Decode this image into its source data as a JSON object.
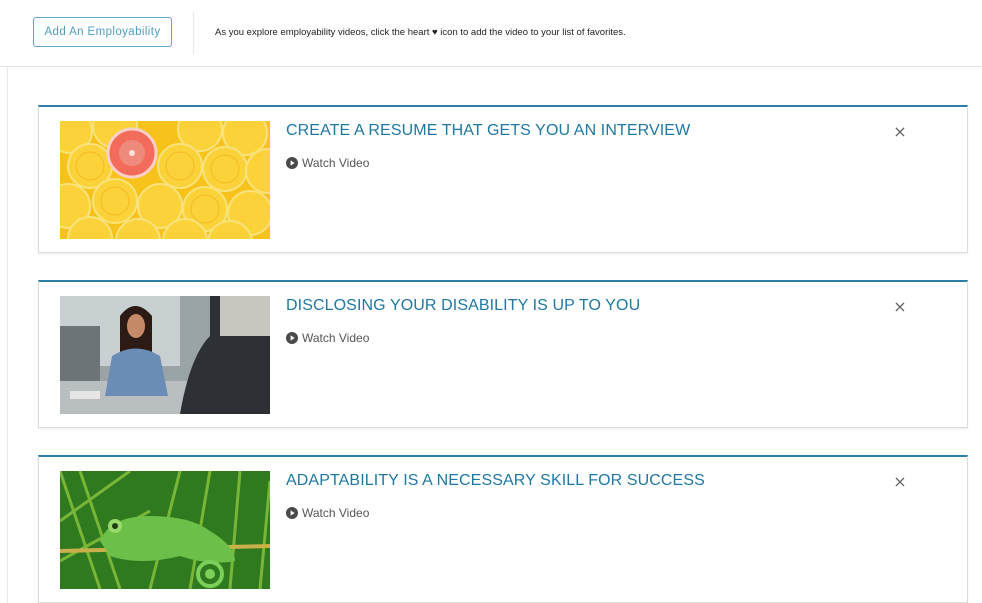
{
  "toolbar": {
    "add_button_label": "Add An Employability",
    "helper_text": "As you explore employability videos, click the heart ♥ icon to add the video to your list of favorites."
  },
  "videos": [
    {
      "title": "CREATE A RESUME THAT GETS YOU AN INTERVIEW",
      "watch_label": "Watch Video",
      "close_label": "×",
      "thumbnail": "citrus-slices-grapefruit"
    },
    {
      "title": "DISCLOSING YOUR DISABILITY IS UP TO YOU",
      "watch_label": "Watch Video",
      "close_label": "×",
      "thumbnail": "job-interview-woman"
    },
    {
      "title": "ADAPTABILITY IS A NECESSARY SKILL FOR SUCCESS",
      "watch_label": "Watch Video",
      "close_label": "×",
      "thumbnail": "chameleon-on-leaf"
    }
  ],
  "colors": {
    "accent": "#1e78a4",
    "card_top_border": "#2b7fa8",
    "button_border": "#5fa9c8"
  }
}
